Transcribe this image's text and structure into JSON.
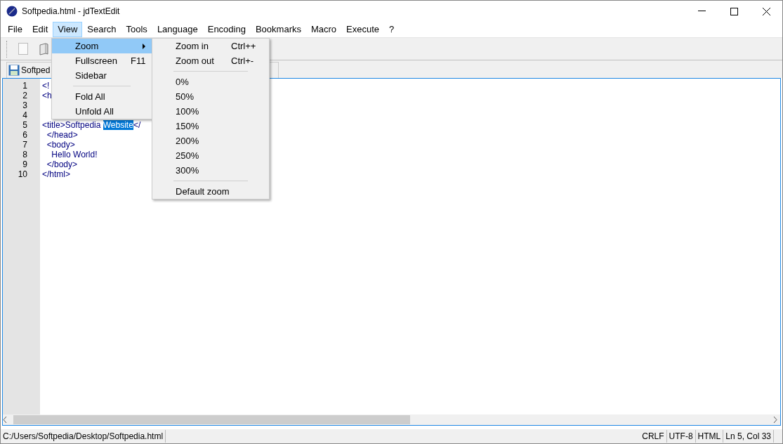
{
  "window": {
    "title": "Softpedia.html - jdTextEdit"
  },
  "menubar": [
    {
      "label": "File",
      "selected": false
    },
    {
      "label": "Edit",
      "selected": false
    },
    {
      "label": "View",
      "selected": true
    },
    {
      "label": "Search",
      "selected": false
    },
    {
      "label": "Tools",
      "selected": false
    },
    {
      "label": "Language",
      "selected": false
    },
    {
      "label": "Encoding",
      "selected": false
    },
    {
      "label": "Bookmarks",
      "selected": false
    },
    {
      "label": "Macro",
      "selected": false
    },
    {
      "label": "Execute",
      "selected": false
    },
    {
      "label": "?",
      "selected": false
    }
  ],
  "tab": {
    "label": "Softped"
  },
  "editor": {
    "lines": [
      {
        "number": "1",
        "text": "<!"
      },
      {
        "number": "2",
        "text": "<h"
      },
      {
        "number": "3"
      },
      {
        "number": "4"
      },
      {
        "number": "5",
        "text": "<title>Softpedia ",
        "selection": "Website",
        "after": "</"
      },
      {
        "number": "6",
        "text": "  </head>"
      },
      {
        "number": "7",
        "text": "  <body>"
      },
      {
        "number": "8",
        "text": "    Hello World!"
      },
      {
        "number": "9",
        "text": "  </body>"
      },
      {
        "number": "10",
        "text": "</html>"
      }
    ]
  },
  "view_menu": [
    {
      "kind": "item",
      "label": "Zoom",
      "submenu": true,
      "selected": true
    },
    {
      "kind": "item",
      "label": "Fullscreen",
      "shortcut": "F11",
      "selected": false
    },
    {
      "kind": "item",
      "label": "Sidebar",
      "selected": false
    },
    {
      "kind": "separator"
    },
    {
      "kind": "item",
      "label": "Fold All",
      "selected": false
    },
    {
      "kind": "item",
      "label": "Unfold All",
      "selected": false
    }
  ],
  "zoom_menu": [
    {
      "kind": "item",
      "label": "Zoom in",
      "shortcut": "Ctrl++"
    },
    {
      "kind": "item",
      "label": "Zoom out",
      "shortcut": "Ctrl+-"
    },
    {
      "kind": "separator"
    },
    {
      "kind": "item",
      "label": "0%"
    },
    {
      "kind": "item",
      "label": "50%"
    },
    {
      "kind": "item",
      "label": "100%"
    },
    {
      "kind": "item",
      "label": "150%"
    },
    {
      "kind": "item",
      "label": "200%"
    },
    {
      "kind": "item",
      "label": "250%"
    },
    {
      "kind": "item",
      "label": "300%"
    },
    {
      "kind": "separator"
    },
    {
      "kind": "item",
      "label": "Default zoom"
    }
  ],
  "status_bar": {
    "path": "C:/Users/Softpedia/Desktop/Softpedia.html",
    "fields": [
      "CRLF",
      "UTF-8",
      "HTML",
      "Ln 5, Col 33"
    ]
  }
}
